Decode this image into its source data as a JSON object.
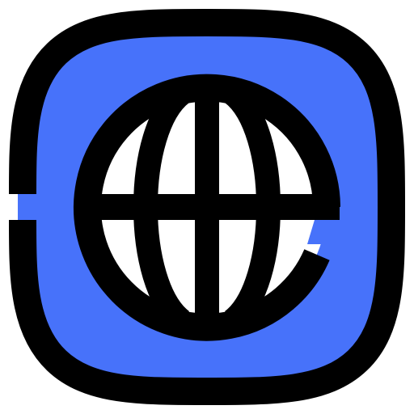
{
  "icon": {
    "name": "globe-app-icon",
    "colors": {
      "fill": "#4772fa",
      "stroke": "#000000",
      "globe_fill": "#ffffff",
      "background": "#ffffff"
    }
  }
}
